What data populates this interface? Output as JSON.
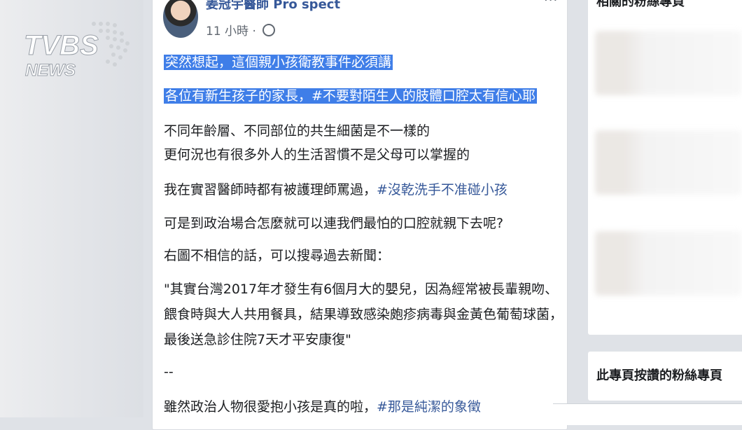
{
  "logo": {
    "top": "TVBS",
    "bottom": "NEWS"
  },
  "post": {
    "author": "姜冠宇醫師 Pro spect",
    "time": "11 小時 ·",
    "more": "···",
    "lines": [
      {
        "text": "突然想起，這個親小孩衛教事件必須講",
        "highlight": true
      },
      {
        "text": "各位有新生孩子的家長，#不要對陌生人的肢體口腔太有信心耶",
        "highlight": true
      },
      {
        "text": "不同年齡層、不同部位的共生細菌是不一樣的"
      },
      {
        "text": "更何況也有很多外人的生活習慣不是父母可以掌握的"
      },
      {
        "pre": "我在實習醫師時都有被護理師罵過，",
        "tag": "#沒乾洗手不准碰小孩"
      },
      {
        "text": "可是到政治場合怎麼就可以連我們最怕的口腔就親下去呢?"
      },
      {
        "text": "右圖不相信的話，可以搜尋過去新聞："
      },
      {
        "text": "\"其實台灣2017年才發生有6個月大的嬰兒，因為經常被長輩親吻、"
      },
      {
        "text": "餵食時與大人共用餐具，結果導致感染皰疹病毒與金黃色葡萄球菌，"
      },
      {
        "text": "最後送急診住院7天才平安康復\""
      },
      {
        "text": "--"
      },
      {
        "pre": "雖然政治人物很愛抱小孩是真的啦，",
        "tag": "#那是純潔的象徵"
      }
    ]
  },
  "sidebar": {
    "related_title": "相關的粉絲專頁",
    "liked_title": "此專頁按讚的粉絲專頁"
  },
  "colors": {
    "highlight": "#3f7ee8",
    "link": "#365899"
  }
}
